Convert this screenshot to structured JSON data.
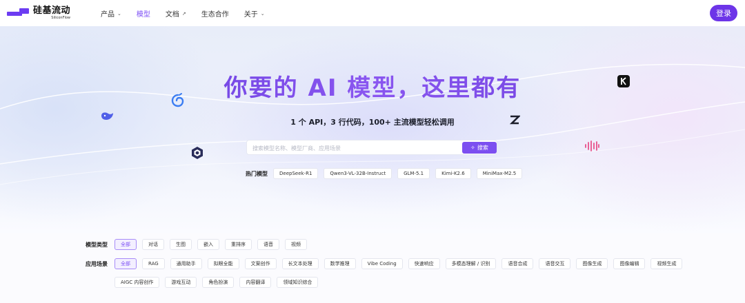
{
  "nav": {
    "logo_cn": "硅基流动",
    "logo_en": "SiliconFlow",
    "menu": [
      {
        "label": "产品",
        "suffix": "⌄"
      },
      {
        "label": "模型",
        "suffix": ""
      },
      {
        "label": "文档",
        "suffix": "↗"
      },
      {
        "label": "生态合作",
        "suffix": ""
      },
      {
        "label": "关于",
        "suffix": "⌄"
      }
    ],
    "login": "登录"
  },
  "hero": {
    "title": "你要的 AI 模型，这里都有",
    "subtitle": "1 个 API，3 行代码，100+ 主流模型轻松调用",
    "search_placeholder": "搜索模型名称、模型厂商、应用场景",
    "search_button": "搜索",
    "hot_label": "热门模型",
    "hot_models": [
      "DeepSeek-R1",
      "Qwen3-VL-32B-Instruct",
      "GLM-5.1",
      "Kimi-K2.6",
      "MiniMax-M2.5"
    ],
    "floating_icons": [
      "whale-logo-icon",
      "swirl-logo-icon",
      "hexagon-logo-icon",
      "z-logo-icon",
      "k-logo-icon",
      "soundwave-logo-icon"
    ]
  },
  "filters": {
    "type_label": "模型类型",
    "types": [
      "全部",
      "对话",
      "生图",
      "嵌入",
      "重排序",
      "语音",
      "视频"
    ],
    "scene_label": "应用场景",
    "scenes_row1": [
      "全部",
      "RAG",
      "通用助手",
      "拟眼全能",
      "文案创作",
      "长文本处理",
      "数学推理",
      "Vibe Coding",
      "快速响应",
      "多模态理解 / 识别",
      "语音合成",
      "语音交互",
      "图像生成",
      "图像编辑",
      "视频生成"
    ],
    "scenes_row2": [
      "AIGC 内容创作",
      "游戏互动",
      "角色扮演",
      "内容翻译",
      "领域知识综合"
    ]
  },
  "colors": {
    "brand": "#6d35e8",
    "accent": "#7c4ff0",
    "title_gradient_start": "#5b36d8",
    "title_gradient_end": "#8a56f0"
  }
}
